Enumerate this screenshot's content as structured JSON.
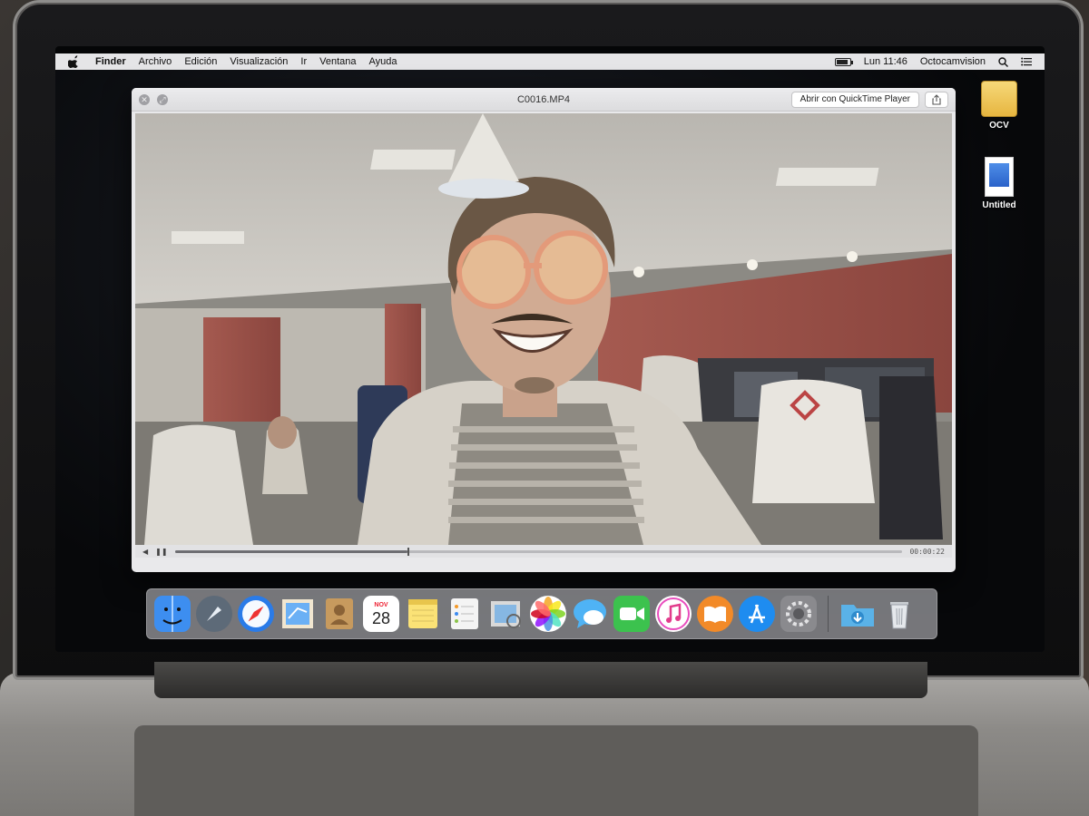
{
  "menubar": {
    "items": [
      "Finder",
      "Archivo",
      "Edición",
      "Visualización",
      "Ir",
      "Ventana",
      "Ayuda"
    ],
    "clock": "Lun 11:46",
    "user": "Octocamvision",
    "battery_level": 0.9
  },
  "desktop": {
    "icons": [
      {
        "label": "OCV",
        "kind": "drive"
      },
      {
        "label": "Untitled",
        "kind": "document"
      }
    ]
  },
  "quicklook": {
    "title": "C0016.MP4",
    "open_button": "Abrir con QuickTime Player",
    "elapsed": "00:00:22",
    "progress": 0.32
  },
  "dock": {
    "apps": [
      {
        "name": "finder-icon",
        "color": "#3d8ef0"
      },
      {
        "name": "launchpad-icon",
        "color": "#5d6a78"
      },
      {
        "name": "safari-icon",
        "color": "#2a7be8"
      },
      {
        "name": "mail-icon",
        "color": "#6bb0f5"
      },
      {
        "name": "contacts-icon",
        "color": "#c79a5e"
      },
      {
        "name": "calendar-icon",
        "color": "#ffffff"
      },
      {
        "name": "notes-icon",
        "color": "#fbe276"
      },
      {
        "name": "reminders-icon",
        "color": "#f4f4f4"
      },
      {
        "name": "preview-icon",
        "color": "#d9d9d9"
      },
      {
        "name": "photos-icon",
        "color": "#ffffff"
      },
      {
        "name": "messages-icon",
        "color": "#4fb3f5"
      },
      {
        "name": "facetime-icon",
        "color": "#3cc24e"
      },
      {
        "name": "itunes-icon",
        "color": "#ffffff"
      },
      {
        "name": "ibooks-icon",
        "color": "#f28a28"
      },
      {
        "name": "app-store-icon",
        "color": "#1e8cf0"
      },
      {
        "name": "system-preferences-icon",
        "color": "#8a8a8e"
      }
    ],
    "calendar": {
      "month": "NOV",
      "day": "28"
    },
    "downloads_color": "#5ab2e8",
    "trash_color": "#c9cdd2"
  }
}
